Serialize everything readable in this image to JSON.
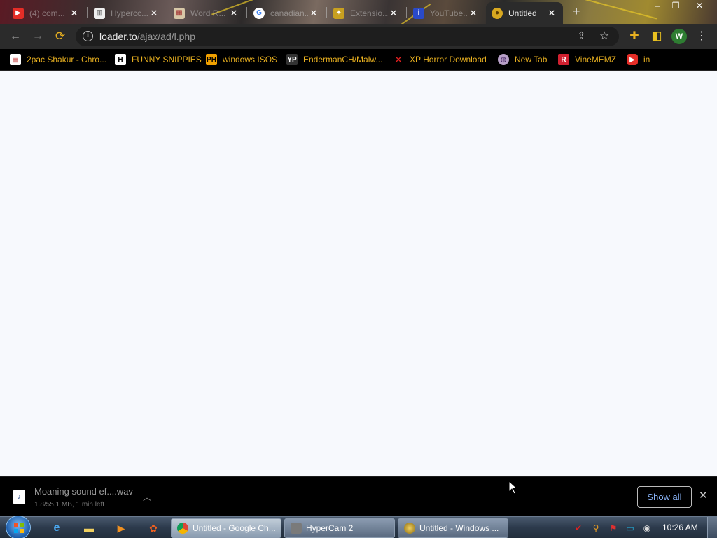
{
  "browser": {
    "tabs": [
      {
        "title": "(4) com...",
        "favicon": "youtube-icon",
        "active": false
      },
      {
        "title": "Hypercc...",
        "favicon": "museum-icon",
        "active": false
      },
      {
        "title": "Word R...",
        "favicon": "image-icon",
        "active": false
      },
      {
        "title": "canadian...",
        "favicon": "google-icon",
        "active": false
      },
      {
        "title": "Extensio...",
        "favicon": "extension-icon",
        "active": false
      },
      {
        "title": "YouTube...",
        "favicon": "app-icon",
        "active": false
      },
      {
        "title": "Untitled",
        "favicon": "loader-icon",
        "active": true
      }
    ],
    "new_tab_glyph": "+",
    "window_controls": {
      "minimize": "–",
      "maximize": "❐",
      "close": "✕"
    },
    "address": {
      "host": "loader.to",
      "path": "/ajax/ad/l.php"
    },
    "profile_initial": "W",
    "bookmarks": [
      {
        "label": "2pac Shakur - Chro...",
        "favicon": "calendar-icon"
      },
      {
        "label": "FUNNY SNIPPIES",
        "favicon": "h-icon"
      },
      {
        "label": "windows ISOS",
        "favicon": "ph-icon"
      },
      {
        "label": "EndermanCH/Malw...",
        "favicon": "yp-icon"
      },
      {
        "label": "XP Horror Download",
        "favicon": "x-icon"
      },
      {
        "label": "New Tab",
        "favicon": "globe-icon"
      },
      {
        "label": "VineMEMZ",
        "favicon": "r-icon"
      },
      {
        "label": "in",
        "favicon": "youtube-icon"
      }
    ]
  },
  "download_shelf": {
    "file_name": "Moaning sound ef....wav",
    "status": "1.8/55.1 MB, 1 min left",
    "show_all_label": "Show all"
  },
  "taskbar": {
    "tasks": [
      {
        "label": "Untitled - Google Ch...",
        "icon": "chrome-icon",
        "active": true
      },
      {
        "label": "HyperCam 2",
        "icon": "hypercam-icon",
        "active": false
      },
      {
        "label": "Untitled - Windows ...",
        "icon": "media-player-icon",
        "active": false
      }
    ],
    "clock": "10:26 AM"
  },
  "colors": {
    "bookmark_text": "#e8b020",
    "toolbar_bg": "#2b2b2b",
    "page_bg": "#f7f9fd",
    "show_all_text": "#8ab4f8"
  }
}
